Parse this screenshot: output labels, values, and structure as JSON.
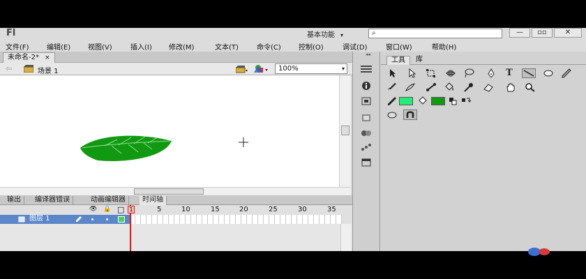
{
  "app": {
    "logo": "Fl",
    "workspace": "基本功能",
    "workspace_arrow": "▾",
    "search_icon": "⌕",
    "win_minimize": "—",
    "win_restore": "▫▫",
    "win_close": "✕"
  },
  "menu": [
    "文件(F)",
    "编辑(E)",
    "视图(V)",
    "插入(I)",
    "修改(M)",
    "文本(T)",
    "命令(C)",
    "控制(O)",
    "调试(D)",
    "窗口(W)",
    "帮助(H)"
  ],
  "document": {
    "tab_label": "未命名-2*",
    "tab_close": "×",
    "back_arrow": "⇦",
    "scene_label": "场景 1",
    "zoom": "100%",
    "zoom_arrow": "▾"
  },
  "panels": {
    "tabs": [
      "输出",
      "编译器错误",
      "动画编辑器",
      "时间轴"
    ],
    "active_tab": 3
  },
  "timeline": {
    "ticks": [
      "1",
      "5",
      "10",
      "15",
      "20",
      "25",
      "30",
      "35"
    ],
    "layer_name": "图层 1",
    "header_icons": [
      "👁",
      "🔒",
      "□"
    ]
  },
  "tools_panel": {
    "tabs": [
      "工具",
      "库"
    ],
    "collapse_arrows": "◂◂",
    "stroke_color": "#22ee77",
    "fill_color": "#119911"
  },
  "colors": {
    "leaf": "#119911",
    "leaf_vein": "#8fe08f",
    "layer_highlight": "#5b86c9",
    "playhead": "#cc2222"
  }
}
